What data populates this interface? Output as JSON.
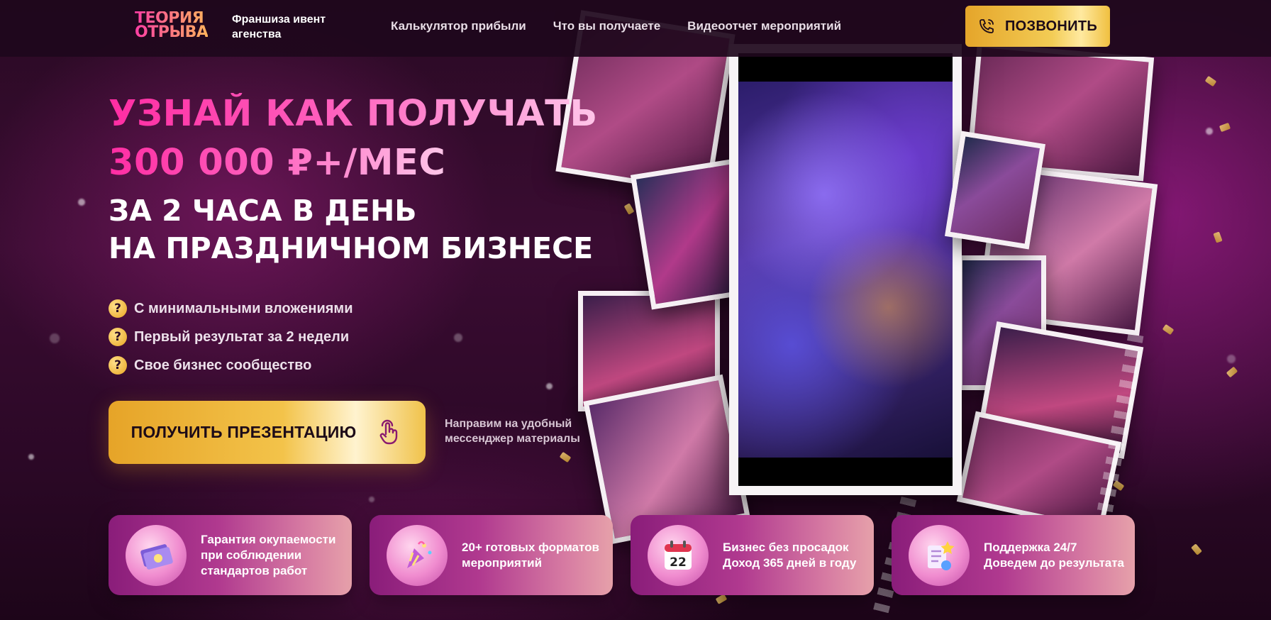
{
  "header": {
    "logo_line1": "ТЕОРИЯ",
    "logo_line2": "ОТРЫВА",
    "franchise_label": "Франшиза ивент агенства",
    "nav": [
      {
        "label": "Калькулятор прибыли"
      },
      {
        "label": "Что вы получаете"
      },
      {
        "label": "Видеоотчет мероприятий"
      }
    ],
    "call_button": "ПОЗВОНИТЬ"
  },
  "hero": {
    "title_line1": "УЗНАЙ КАК ПОЛУЧАТЬ",
    "title_line2": "300 000 ₽+/МЕС",
    "subtitle_line1": "ЗА 2 ЧАСА В ДЕНЬ",
    "subtitle_line2": "НА ПРАЗДНИЧНОМ БИЗНЕСЕ",
    "benefits": [
      {
        "label": "С минимальными вложениями"
      },
      {
        "label": "Первый результат за 2 недели"
      },
      {
        "label": "Свое бизнес сообщество"
      }
    ],
    "benefit_icon_glyph": "?",
    "cta_button": "ПОЛУЧИТЬ ПРЕЗЕНТАЦИЮ",
    "cta_note": "Направим на удобный мессенджер материалы"
  },
  "feature_cards": [
    {
      "icon": "money-stack-icon",
      "line1": "Гарантия окупаемости",
      "line2": "при соблюдении",
      "line3": "стандартов работ"
    },
    {
      "icon": "party-popper-icon",
      "line1": "20+ готовых форматов",
      "line2": "мероприятий",
      "line3": ""
    },
    {
      "icon": "calendar-icon",
      "line1": "Бизнес без просадок",
      "line2": "Доход 365 дней в году",
      "line3": "",
      "calendar_day": "22"
    },
    {
      "icon": "support-checklist-icon",
      "line1": "Поддержка 24/7",
      "line2": "Доведем до результата",
      "line3": ""
    }
  ],
  "colors": {
    "accent_pink": "#ff2da3",
    "accent_gold": "#f3c34a",
    "card_gradient_start": "#8a1d7a",
    "background_dark": "#2a0a24"
  }
}
